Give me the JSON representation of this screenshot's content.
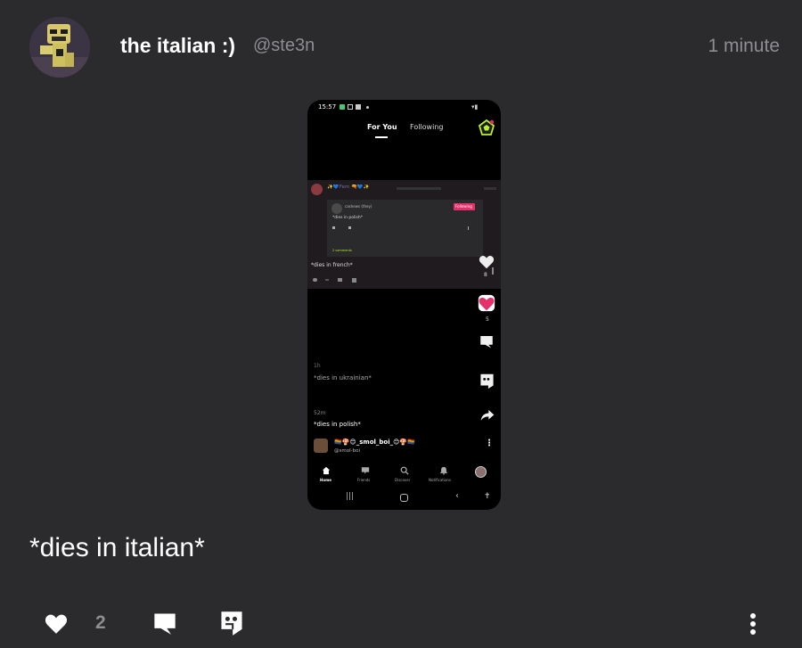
{
  "post": {
    "author_name": "the italian :)",
    "author_handle": "@ste3n",
    "timestamp": "1 minute",
    "text": "*dies in italian*",
    "like_count": "2"
  },
  "screenshot": {
    "status_time": "15:57",
    "tabs": [
      "For You",
      "Following"
    ],
    "nested_post": {
      "header_name": "✨💙Fem 🔫💙✨",
      "quoted_name": "cashews (they)",
      "quoted_text": "*dies in polish*",
      "quoted_badge": "Following",
      "quoted_link": "2 comments",
      "text": "*dies in french*",
      "like_count": "8"
    },
    "side_like_count": "5",
    "post_ukr_time": "1h",
    "post_ukr_text": "*dies in ukrainian*",
    "post_pol_time": "52m",
    "post_pol_text": "*dies in polish*",
    "user_name": "🏳️‍🌈🍄😊_smol_boi_😊🍄🏳️‍🌈",
    "user_handle": "@smol-boi",
    "nav": [
      "Home",
      "Friends",
      "Discover",
      "Notifications"
    ]
  },
  "colors": {
    "background": "#2b2b2e",
    "muted": "#8d8d92",
    "like_pink": "#e5306a",
    "accent_green": "#b9f227"
  },
  "icons": [
    "heart-icon",
    "comment-icon",
    "quote-icon",
    "more-icon",
    "share-icon",
    "home-icon",
    "friends-icon",
    "search-icon",
    "bell-icon"
  ]
}
